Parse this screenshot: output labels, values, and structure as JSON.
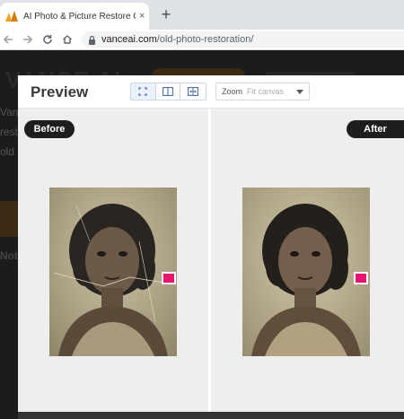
{
  "browser": {
    "tab_title": "AI Photo & Picture Restore Onli",
    "tab_close": "×",
    "new_tab": "+",
    "url_domain": "vanceai.com",
    "url_path": "/old-photo-restoration/"
  },
  "site": {
    "logo": "VANCE AI",
    "line1": "Van",
    "line2": "rest",
    "line3": "old",
    "line4": "Not"
  },
  "modal": {
    "title": "Preview",
    "zoom_label": "Zoom",
    "zoom_placeholder": "Fit canvas",
    "before_label": "Before",
    "after_label": "After"
  },
  "colors": {
    "accent": "#e8156f",
    "label_bg": "#1e1e1e"
  }
}
